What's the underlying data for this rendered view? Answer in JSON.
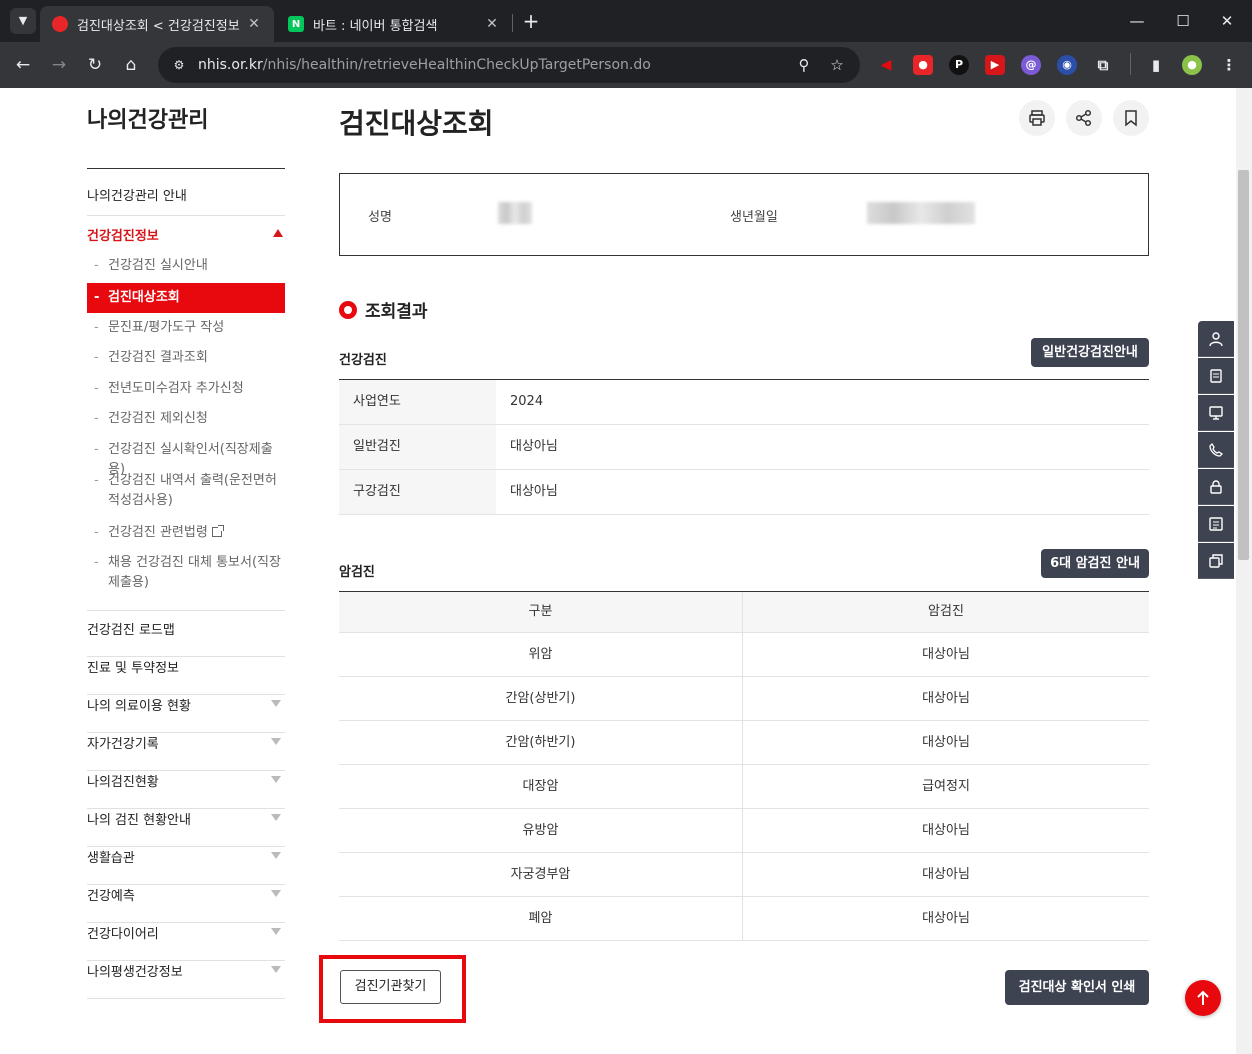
{
  "browser": {
    "tabs": [
      {
        "title": "검진대상조회 < 건강검진정보",
        "favicon": "nhis-favicon",
        "active": true
      },
      {
        "title": "바트 : 네이버 통합검색",
        "favicon": "naver-favicon",
        "favicon_letter": "N",
        "active": false
      }
    ],
    "url_host": "nhis.or.kr",
    "url_path": "/nhis/healthin/retrieveHealthinCheckUpTargetPerson.do"
  },
  "sidebar": {
    "title": "나의건강관리",
    "items_top": [
      {
        "label": "나의건강관리 안내"
      },
      {
        "label": "건강검진정보",
        "expanded": true
      }
    ],
    "sub_items": [
      {
        "label": "건강검진 실시안내"
      },
      {
        "label": "검진대상조회",
        "current": true
      },
      {
        "label": "문진표/평가도구 작성"
      },
      {
        "label": "건강검진 결과조회"
      },
      {
        "label": "전년도미수검자 추가신청"
      },
      {
        "label": "건강검진 제외신청"
      },
      {
        "label": "건강검진 실시확인서(직장제출용)"
      },
      {
        "label": "건강검진 내역서 출력(운전면허적성검사용)"
      },
      {
        "label": "건강검진 관련법령"
      },
      {
        "label": "채용 건강검진 대체 통보서(직장제출용)"
      }
    ],
    "items_bottom": [
      {
        "label": "건강검진 로드맵"
      },
      {
        "label": "진료 및 투약정보"
      },
      {
        "label": "나의 의료이용 현황"
      },
      {
        "label": "자가건강기록"
      },
      {
        "label": "나의검진현황"
      },
      {
        "label": "나의 검진 현황안내"
      },
      {
        "label": "생활습관"
      },
      {
        "label": "건강예측"
      },
      {
        "label": "건강다이어리"
      },
      {
        "label": "나의평생건강정보"
      }
    ]
  },
  "main": {
    "title": "검진대상조회",
    "person": {
      "name_label": "성명",
      "birth_label": "생년월일"
    },
    "section_title": "조회결과",
    "health": {
      "heading": "건강검진",
      "guide_button": "일반건강검진안내",
      "rows": [
        {
          "key": "사업연도",
          "value": "2024"
        },
        {
          "key": "일반검진",
          "value": "대상아님"
        },
        {
          "key": "구강검진",
          "value": "대상아님"
        }
      ]
    },
    "cancer": {
      "heading": "암검진",
      "guide_button": "6대 암검진 안내",
      "columns": [
        "구분",
        "암검진"
      ],
      "rows": [
        [
          "위암",
          "대상아님"
        ],
        [
          "간암(상반기)",
          "대상아님"
        ],
        [
          "간암(하반기)",
          "대상아님"
        ],
        [
          "대장암",
          "급여정지"
        ],
        [
          "유방암",
          "대상아님"
        ],
        [
          "자궁경부암",
          "대상아님"
        ],
        [
          "폐암",
          "대상아님"
        ]
      ]
    },
    "find_button": "검진기관찾기",
    "print_button": "검진대상 확인서 인쇄"
  },
  "colors": {
    "accent": "#e8090f",
    "dark_button": "#3e4352"
  }
}
